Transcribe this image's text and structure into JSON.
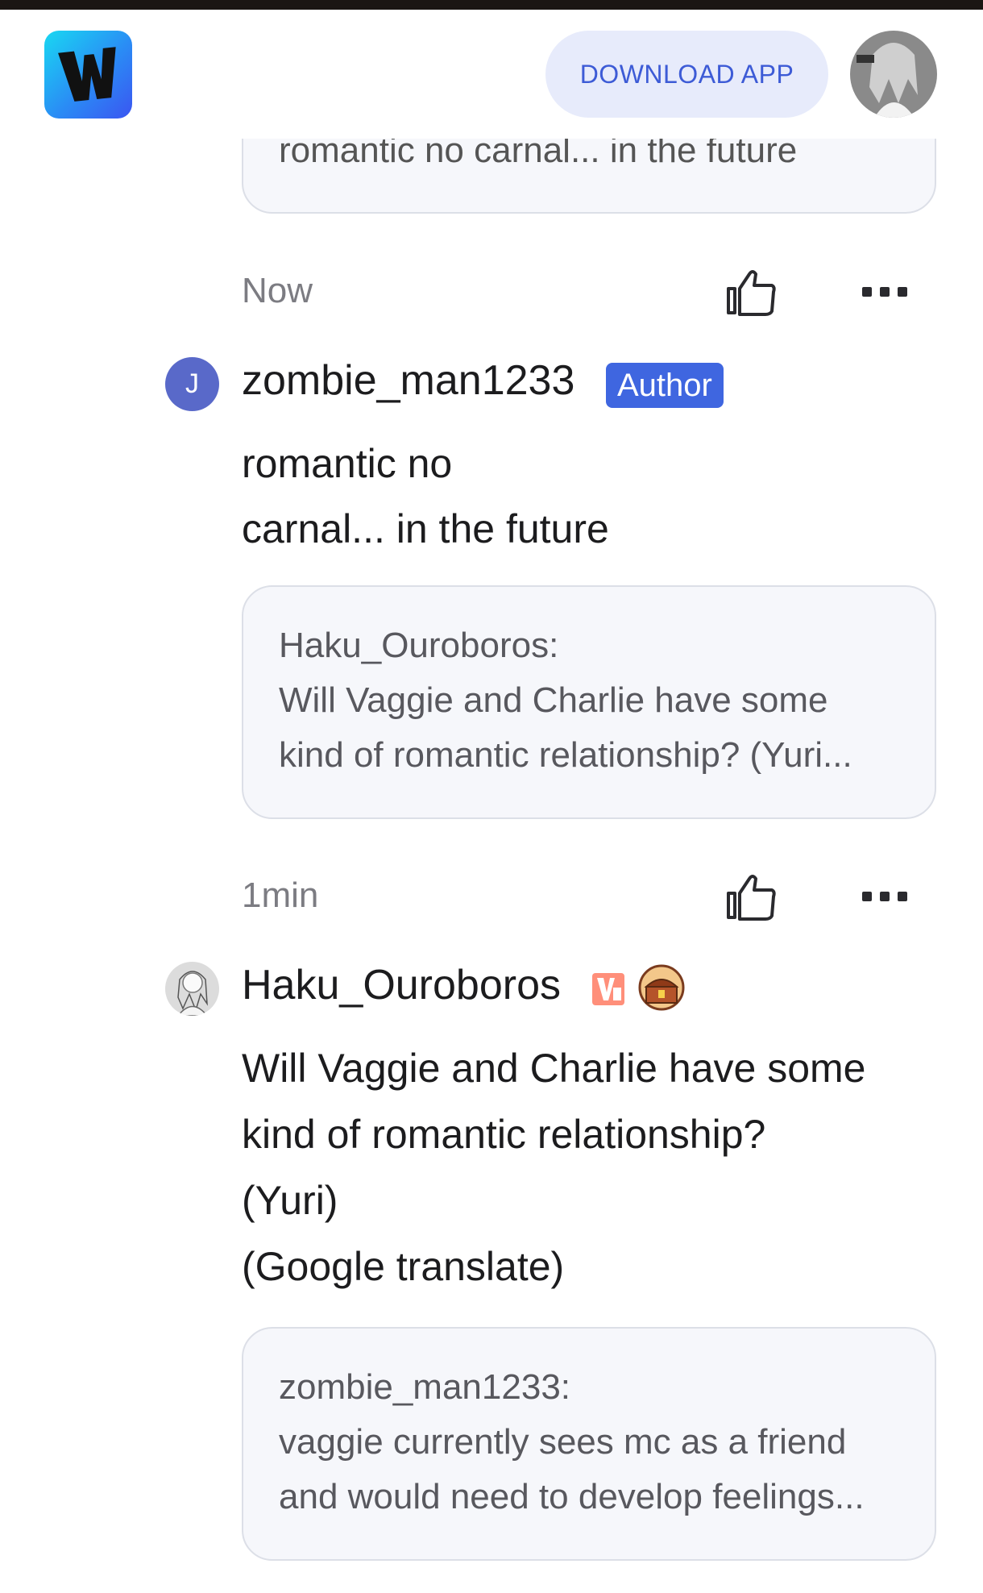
{
  "header": {
    "download_label": "DOWNLOAD APP",
    "logo_icon": "webnovel-w-logo",
    "avatar_icon": "user-avatar-manga"
  },
  "partial_quote": {
    "text": "romantic no carnal... in the future"
  },
  "comments": [
    {
      "time": "Now",
      "user": "zombie_man1233",
      "avatar_letter": "J",
      "badge": "Author",
      "body": [
        "romantic no",
        "carnal... in the future"
      ],
      "quote_user": "Haku_Ouroboros:",
      "quote_lines": [
        "Will Vaggie and Charlie have some",
        "kind of romantic relationship? (Yuri..."
      ]
    },
    {
      "time": "1min",
      "user": "Haku_Ouroboros",
      "body": [
        "Will Vaggie and Charlie have some",
        "kind of romantic relationship?",
        "(Yuri)",
        "(Google translate)"
      ],
      "quote_user": "zombie_man1233:",
      "quote_lines": [
        "vaggie currently sees mc as a friend",
        "and would need to develop feelings..."
      ]
    }
  ],
  "colors": {
    "accent": "#3f66e0",
    "download_bg": "#e7ebfb",
    "quote_bg": "#f6f7fb"
  }
}
